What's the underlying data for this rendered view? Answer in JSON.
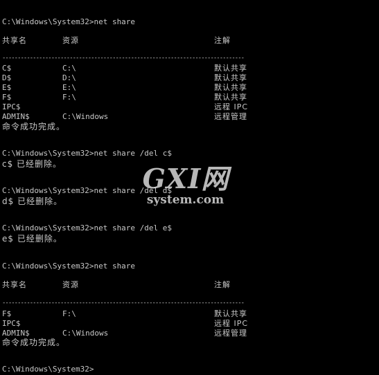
{
  "window": {
    "background": "#000000",
    "text_color": "#c8c8c8"
  },
  "console": {
    "prompt1": "C:\\Windows\\System32>net share",
    "header1": {
      "col_name": "共享名",
      "col_resource": "资源",
      "col_remark": "注解"
    },
    "separator1": "-------------------------------------------------------------------------------",
    "table1": [
      {
        "name": "C$",
        "resource": "C:\\",
        "remark": "默认共享"
      },
      {
        "name": "D$",
        "resource": "D:\\",
        "remark": "默认共享"
      },
      {
        "name": "E$",
        "resource": "E:\\",
        "remark": "默认共享"
      },
      {
        "name": "F$",
        "resource": "F:\\",
        "remark": "默认共享"
      },
      {
        "name": "IPC$",
        "resource": "",
        "remark": "远程 IPC"
      },
      {
        "name": "ADMIN$",
        "resource": "C:\\Windows",
        "remark": "远程管理"
      }
    ],
    "success1": "命令成功完成。",
    "prompt2": "C:\\Windows\\System32>net share /del c$",
    "result2": "c$ 已经删除。",
    "prompt3": "C:\\Windows\\System32>net share /del d$",
    "result3": "d$ 已经删除。",
    "prompt4": "C:\\Windows\\System32>net share /del e$",
    "result4": "e$ 已经删除。",
    "prompt5": "C:\\Windows\\System32>net share",
    "header2": {
      "col_name": "共享名",
      "col_resource": "资源",
      "col_remark": "注解"
    },
    "separator2": "-------------------------------------------------------------------------------",
    "table2": [
      {
        "name": "F$",
        "resource": "F:\\",
        "remark": "默认共享"
      },
      {
        "name": "IPC$",
        "resource": "",
        "remark": "远程 IPC"
      },
      {
        "name": "ADMIN$",
        "resource": "C:\\Windows",
        "remark": "远程管理"
      }
    ],
    "success2": "命令成功完成。",
    "prompt6": "C:\\Windows\\System32>"
  },
  "watermark": {
    "logo": "GXI网",
    "sub": "system.com"
  }
}
